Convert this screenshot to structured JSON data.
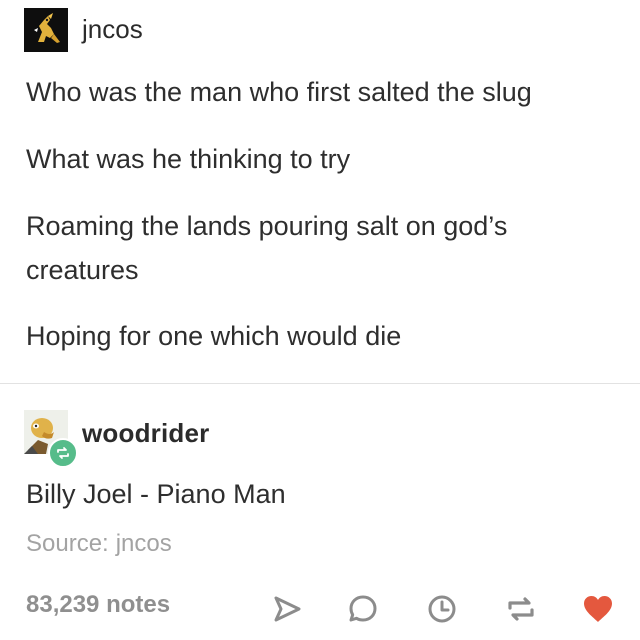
{
  "op": {
    "username": "jncos",
    "lines": [
      "Who was the man who first salted the slug",
      "What was he thinking to try",
      "Roaming the lands pouring salt on god’s creatures",
      "Hoping for one which would die"
    ]
  },
  "reblog": {
    "username": "woodrider",
    "text": "Billy Joel - Piano Man",
    "badge_icon": "reblog-icon",
    "badge_color": "#56bc8a"
  },
  "source": {
    "label": "Source:",
    "name": "jncos"
  },
  "footer": {
    "notes": "83,239 notes",
    "actions": [
      "share-icon",
      "reply-icon",
      "queue-clock-icon",
      "reblog-icon",
      "like-heart-icon"
    ],
    "like_color": "#e4583e"
  }
}
